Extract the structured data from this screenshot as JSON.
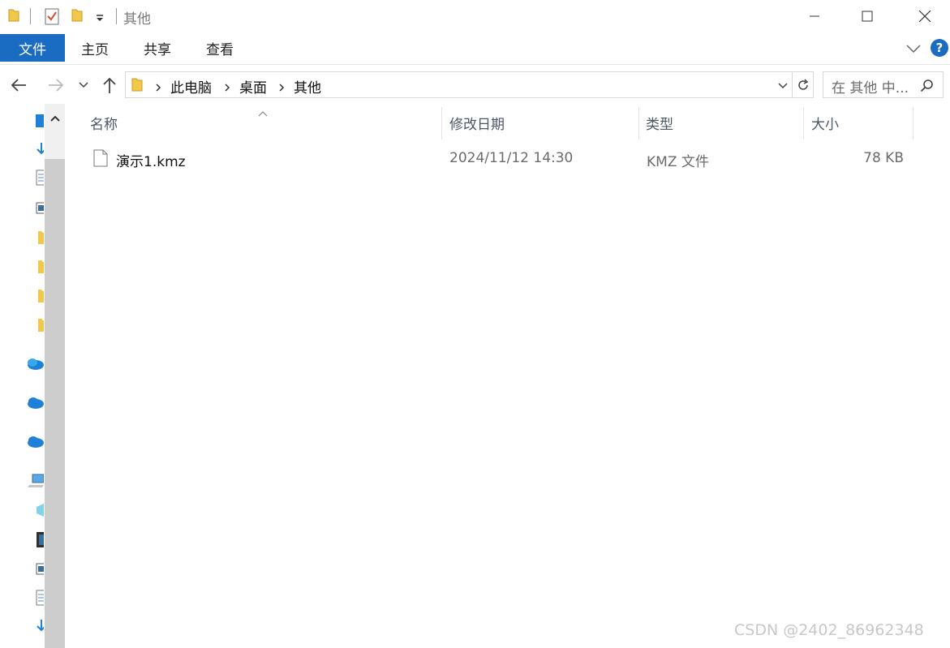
{
  "window": {
    "title": "其他"
  },
  "ribbon": {
    "tabs": [
      {
        "label": "文件"
      },
      {
        "label": "主页"
      },
      {
        "label": "共享"
      },
      {
        "label": "查看"
      }
    ],
    "help_label": "?"
  },
  "nav": {
    "breadcrumbs": [
      "此电脑",
      "桌面",
      "其他"
    ],
    "search_placeholder": "在 其他 中..."
  },
  "columns": {
    "name": "名称",
    "modified": "修改日期",
    "type": "类型",
    "size": "大小"
  },
  "files": [
    {
      "name": "演示1.kmz",
      "modified": "2024/11/12 14:30",
      "type": "KMZ 文件",
      "size": "78 KB"
    }
  ],
  "watermark": "CSDN @2402_86962348",
  "colors": {
    "accent": "#1a6bc2",
    "folder": "#f2c84b",
    "onedrive": "#1e80d6"
  }
}
